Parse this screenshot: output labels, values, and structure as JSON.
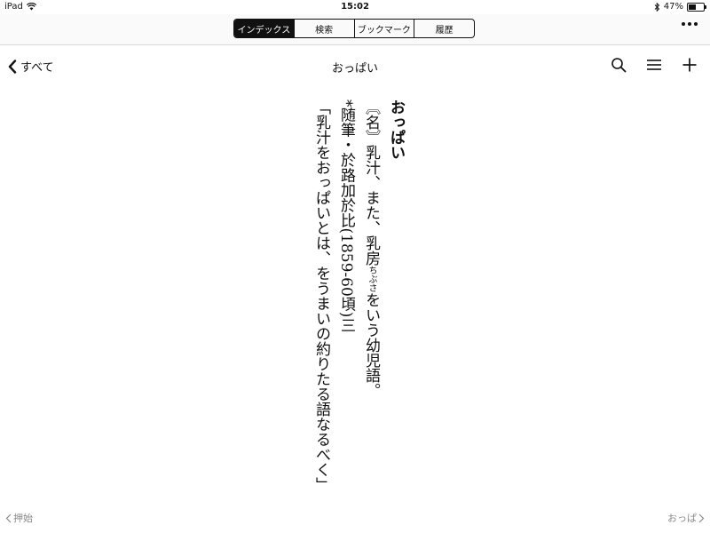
{
  "status_bar": {
    "device": "iPad",
    "time": "15:02",
    "battery": "47%",
    "battery_level": 0.47
  },
  "segments": [
    {
      "label": "インデックス",
      "active": true
    },
    {
      "label": "検索",
      "active": false
    },
    {
      "label": "ブックマーク",
      "active": false
    },
    {
      "label": "履歴",
      "active": false
    }
  ],
  "nav": {
    "back_label": "すべて",
    "title": "おっぱい"
  },
  "entry": {
    "headword": "おっぱい",
    "definition_1": "〘名〙乳汁、また、乳房",
    "definition_ruby": "ちぶさ",
    "definition_2": "をいう幼児語。",
    "citation_source": "*随筆・於路加於比(1859-60頃)三",
    "quote": "「乳汁をおっぱいとは、をうまいの約りたる語なるべく」"
  },
  "footer": {
    "prev_label": "押始",
    "next_label": "おっぱ"
  },
  "colors": {
    "segment_active_bg": "#111111",
    "footer_text": "#8a8a8a"
  },
  "icons": {
    "wifi": "wifi-icon",
    "bluetooth": "bluetooth-icon",
    "battery": "battery-icon",
    "more": "ellipsis-icon",
    "back": "chevron-left-icon",
    "search": "search-icon",
    "list": "list-icon",
    "add": "plus-icon",
    "prev": "chevron-left-icon",
    "next": "chevron-right-icon"
  }
}
